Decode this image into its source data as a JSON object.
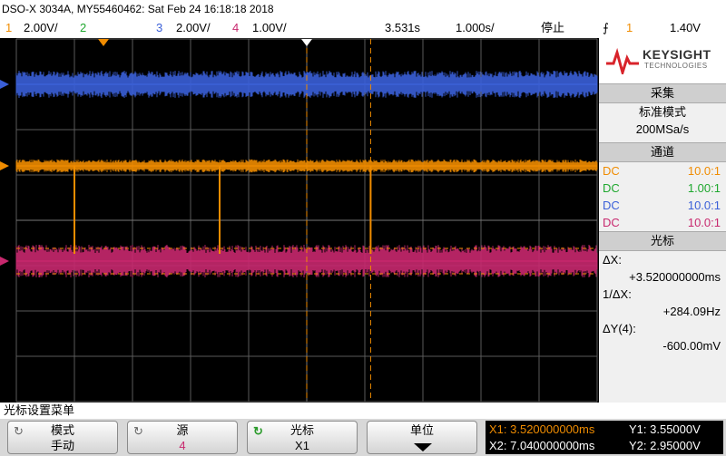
{
  "header": {
    "title": "DSO-X 3034A, MY55460462: Sat Feb 24 16:18:18 2018"
  },
  "channels": [
    {
      "num": "1",
      "scale": "2.00V/",
      "color": "#f08c00"
    },
    {
      "num": "2",
      "scale": "",
      "color": "#1fa82f"
    },
    {
      "num": "3",
      "scale": "2.00V/",
      "color": "#3a5fd8"
    },
    {
      "num": "4",
      "scale": "1.00V/",
      "color": "#c8286e"
    }
  ],
  "timebase": {
    "delay": "3.531s",
    "scale": "1.000s/"
  },
  "run_state": "停止",
  "trigger": {
    "symbol": "⨍",
    "channel": "1",
    "level": "1.40V"
  },
  "brand": {
    "name": "KEYSIGHT",
    "sub": "TECHNOLOGIES"
  },
  "acquire": {
    "header": "采集",
    "mode": "标准模式",
    "rate": "200MSa/s"
  },
  "channel_panel": {
    "header": "通道",
    "rows": [
      {
        "coupling": "DC",
        "probe": "10.0:1",
        "color": "#f08c00"
      },
      {
        "coupling": "DC",
        "probe": "1.00:1",
        "color": "#1fa82f"
      },
      {
        "coupling": "DC",
        "probe": "10.0:1",
        "color": "#3a5fd8"
      },
      {
        "coupling": "DC",
        "probe": "10.0:1",
        "color": "#c8286e"
      }
    ]
  },
  "cursor_panel": {
    "header": "光标",
    "dx_label": "ΔX:",
    "dx_value": "+3.520000000ms",
    "inv_label": "1/ΔX:",
    "inv_value": "+284.09Hz",
    "dy_label": "ΔY(4):",
    "dy_value": "-600.00mV"
  },
  "waveforms": {
    "ch3": {
      "level_div": 3.0,
      "noise_div": 0.25
    },
    "ch1": {
      "level_div": 1.2,
      "noise_div": 0.12,
      "glitch_times_div": [
        1.0,
        3.5,
        6.1
      ]
    },
    "ch4": {
      "level_div": -0.9,
      "noise_div": 0.3
    }
  },
  "markers": {
    "time_cursor_div": 6.1
  },
  "menu": {
    "title": "光标设置菜单"
  },
  "softkeys": [
    {
      "label": "模式",
      "value": "手动",
      "icon": "rotate-icon"
    },
    {
      "label": "源",
      "value": "4",
      "icon": "rotate-icon"
    },
    {
      "label": "光标",
      "value": "X1",
      "icon": "knob-icon"
    },
    {
      "label": "单位",
      "value": "",
      "icon": "down-arrow-icon"
    }
  ],
  "cursor_readout": {
    "x1": "X1: 3.520000000ms",
    "x2": "X2: 7.040000000ms",
    "y1": "Y1: 3.55000V",
    "y2": "Y2: 2.95000V"
  }
}
